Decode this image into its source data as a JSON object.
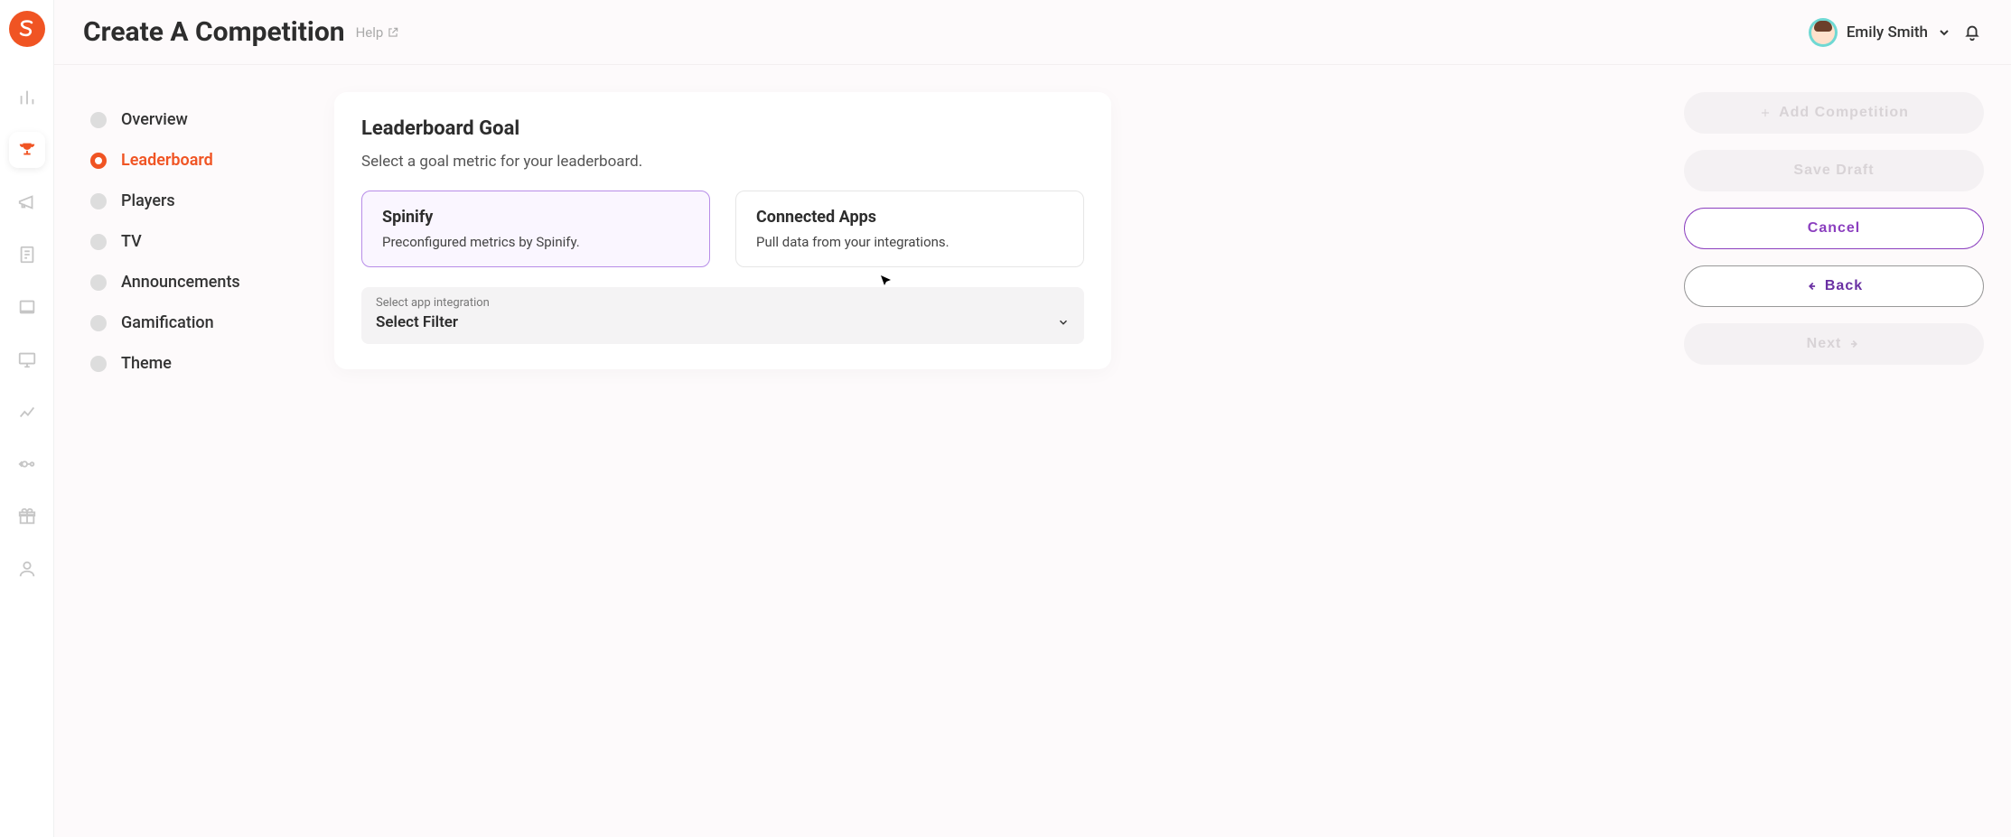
{
  "header": {
    "title": "Create A Competition",
    "help_label": "Help",
    "user_name": "Emily Smith"
  },
  "steps": {
    "items": [
      {
        "label": "Overview"
      },
      {
        "label": "Leaderboard"
      },
      {
        "label": "Players"
      },
      {
        "label": "TV"
      },
      {
        "label": "Announcements"
      },
      {
        "label": "Gamification"
      },
      {
        "label": "Theme"
      }
    ],
    "active_index": 1
  },
  "card": {
    "title": "Leaderboard Goal",
    "subtitle": "Select a goal metric for your leaderboard.",
    "options": [
      {
        "title": "Spinify",
        "desc": "Preconfigured metrics by Spinify."
      },
      {
        "title": "Connected Apps",
        "desc": "Pull data from your integrations."
      }
    ],
    "selected_option_index": 0,
    "select": {
      "label": "Select app integration",
      "value": "Select Filter"
    }
  },
  "actions": {
    "add_competition_label": "Add Competition",
    "save_draft_label": "Save Draft",
    "cancel_label": "Cancel",
    "back_label": "Back",
    "next_label": "Next"
  },
  "colors": {
    "brand_orange": "#f05423",
    "purple": "#8b3fbf",
    "option_selected_border": "#b78de8"
  }
}
